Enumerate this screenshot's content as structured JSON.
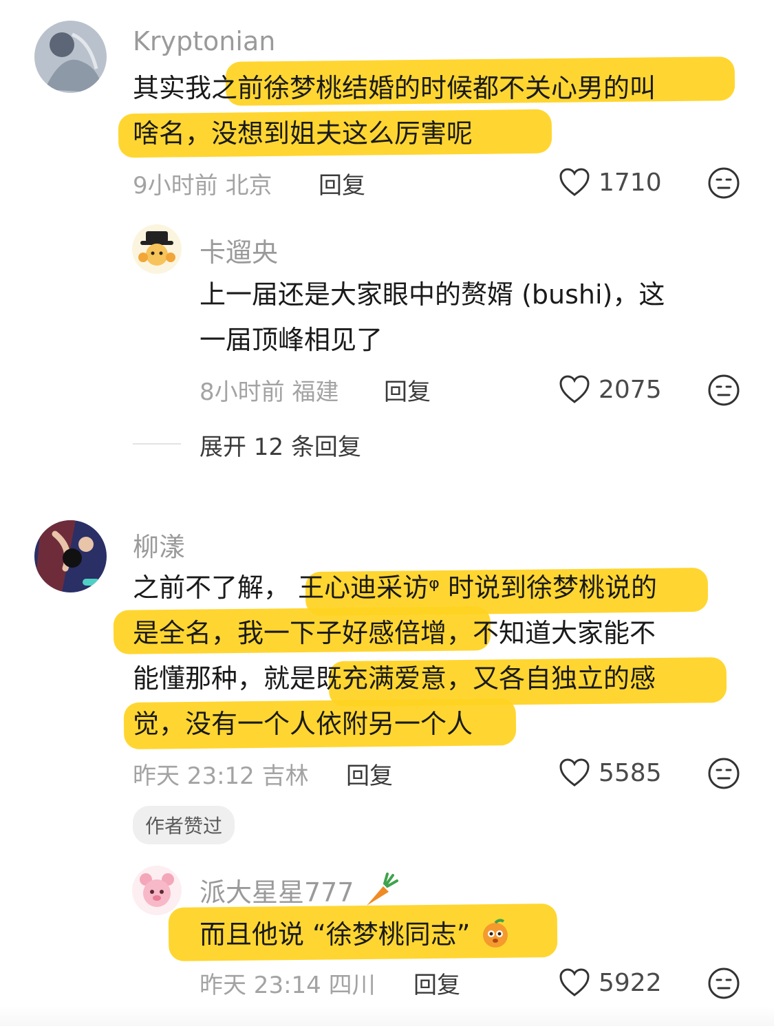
{
  "comments": [
    {
      "username": "Kryptonian",
      "lines": [
        "其实我之前徐梦桃结婚的时候都不关心男的叫",
        "啥名，没想到姐夫这么厉害呢"
      ],
      "time_location": "9小时前 北京",
      "reply_label": "回复",
      "likes": "1710"
    },
    {
      "username": "卡遛央",
      "lines": [
        "上一届还是大家眼中的赘婿 (bushi)，这",
        "一届顶峰相见了"
      ],
      "time_location": "8小时前 福建",
      "reply_label": "回复",
      "likes": "2075"
    },
    {
      "username": "柳漾",
      "lines": [
        "之前不了解， 王心迪采访ᵠ 时说到徐梦桃说的",
        "是全名，我一下子好感倍增，不知道大家能不",
        "能懂那种，就是既充满爱意，又各自独立的感",
        "觉，没有一个人依附另一个人"
      ],
      "time_location": "昨天 23:12 吉林",
      "reply_label": "回复",
      "likes": "5585",
      "badge": "作者赞过"
    },
    {
      "username": "派大星星777",
      "lines": [
        "而且他说 “徐梦桃同志”"
      ],
      "time_location": "昨天 23:14 四川",
      "reply_label": "回复",
      "likes": "5922"
    }
  ],
  "expand_replies": "展开 12 条回复",
  "colors": {
    "highlight": "#ffd21f",
    "meta": "#a3a3a3",
    "name": "#9a9a9a",
    "badge_bg": "#efefef"
  }
}
